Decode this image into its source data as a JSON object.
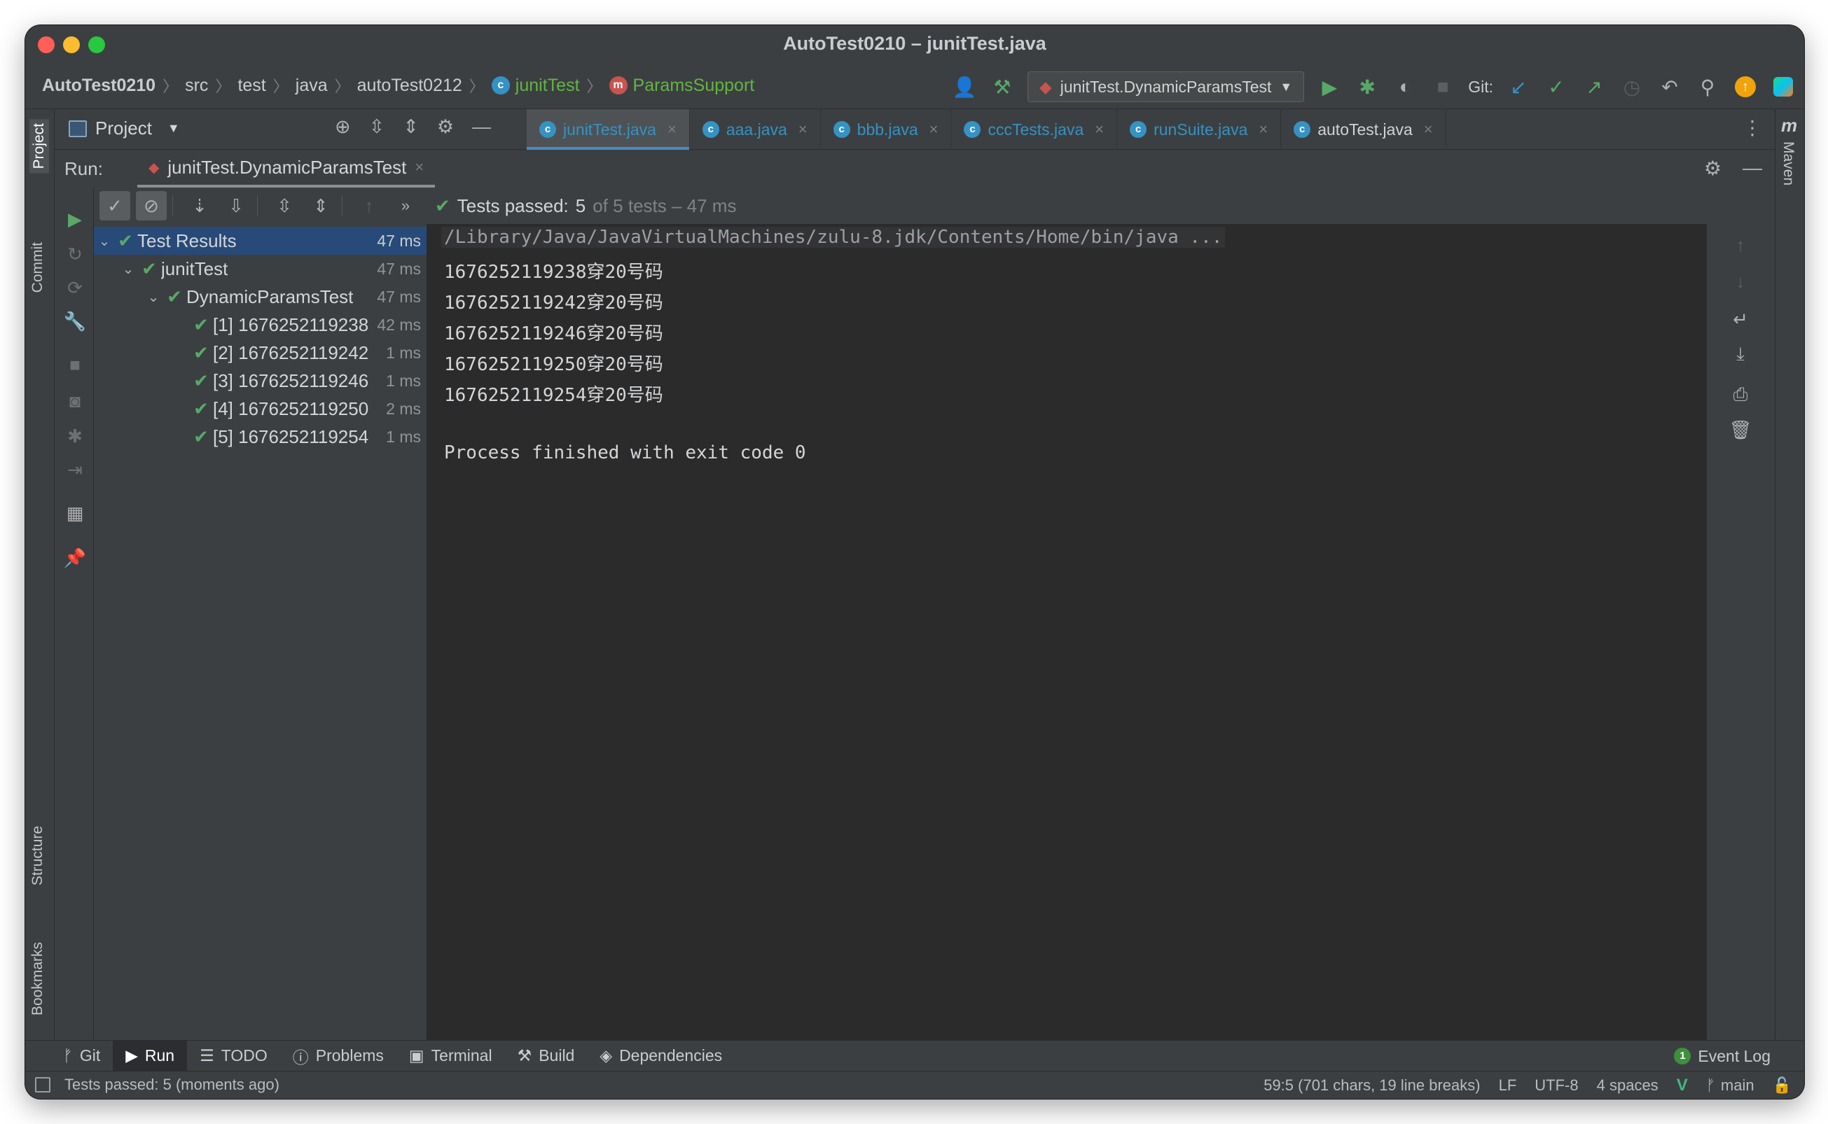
{
  "window": {
    "title": "AutoTest0210 – junitTest.java"
  },
  "breadcrumbs": [
    {
      "label": "AutoTest0210",
      "style": "strong"
    },
    {
      "label": "src"
    },
    {
      "label": "test"
    },
    {
      "label": "java"
    },
    {
      "label": "autoTest0212"
    },
    {
      "label": "junitTest",
      "style": "green",
      "icon": "c"
    },
    {
      "label": "ParamsSupport",
      "style": "green",
      "icon": "m"
    }
  ],
  "toolbar": {
    "run_config": "junitTest.DynamicParamsTest",
    "git_label": "Git:"
  },
  "project_panel": {
    "title": "Project"
  },
  "editor_tabs": [
    {
      "label": "junitTest.java",
      "active": true
    },
    {
      "label": "aaa.java"
    },
    {
      "label": "bbb.java"
    },
    {
      "label": "cccTests.java"
    },
    {
      "label": "runSuite.java"
    },
    {
      "label": "autoTest.java",
      "plain": true
    }
  ],
  "side_tools": {
    "left": [
      "Project",
      "Commit",
      "Structure",
      "Bookmarks"
    ],
    "right": [
      "Maven"
    ]
  },
  "run_panel": {
    "label": "Run:",
    "tab": "junitTest.DynamicParamsTest",
    "status_prefix": "Tests passed:",
    "status_count": "5",
    "status_rest": "of 5 tests – 47 ms"
  },
  "test_tree": [
    {
      "label": "Test Results",
      "time": "47 ms",
      "level": 0,
      "expandable": true,
      "selected": true
    },
    {
      "label": "junitTest",
      "time": "47 ms",
      "level": 1,
      "expandable": true
    },
    {
      "label": "DynamicParamsTest",
      "time": "47 ms",
      "level": 2,
      "expandable": true
    },
    {
      "label": "[1] 1676252119238",
      "time": "42 ms",
      "level": 3
    },
    {
      "label": "[2] 1676252119242",
      "time": "1 ms",
      "level": 3
    },
    {
      "label": "[3] 1676252119246",
      "time": "1 ms",
      "level": 3
    },
    {
      "label": "[4] 1676252119250",
      "time": "2 ms",
      "level": 3
    },
    {
      "label": "[5] 1676252119254",
      "time": "1 ms",
      "level": 3
    }
  ],
  "console": {
    "command": "/Library/Java/JavaVirtualMachines/zulu-8.jdk/Contents/Home/bin/java ...",
    "lines": [
      "1676252119238穿20号码",
      "1676252119242穿20号码",
      "1676252119246穿20号码",
      "1676252119250穿20号码",
      "1676252119254穿20号码"
    ],
    "exit": "Process finished with exit code 0"
  },
  "bottom_tabs": [
    {
      "label": "Git",
      "icon": "branch-icon"
    },
    {
      "label": "Run",
      "icon": "play-icon",
      "active": true
    },
    {
      "label": "TODO",
      "icon": "list-icon"
    },
    {
      "label": "Problems",
      "icon": "info-icon"
    },
    {
      "label": "Terminal",
      "icon": "terminal-icon"
    },
    {
      "label": "Build",
      "icon": "hammer-icon"
    },
    {
      "label": "Dependencies",
      "icon": "layers-icon"
    }
  ],
  "event_log": {
    "label": "Event Log",
    "count": "1"
  },
  "status_bar": {
    "message": "Tests passed: 5 (moments ago)",
    "position": "59:5 (701 chars, 19 line breaks)",
    "line_sep": "LF",
    "encoding": "UTF-8",
    "indent": "4 spaces",
    "branch": "main"
  },
  "colors": {
    "accent": "#4a88c7",
    "pass_green": "#59a869",
    "background": "#2b2b2b",
    "panel": "#3c3f41"
  }
}
